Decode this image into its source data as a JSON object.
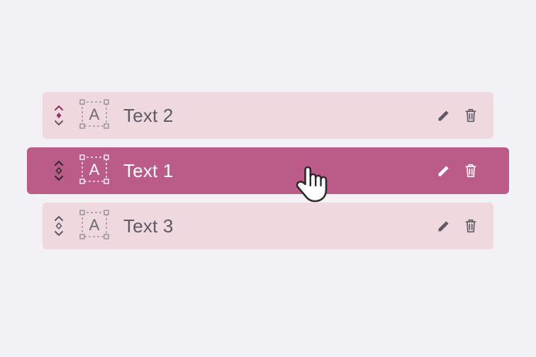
{
  "colors": {
    "row_normal_bg": "#f0d8df",
    "row_active_bg": "#ba5b88",
    "text_muted": "#5b5b66",
    "text_on_active": "#ffffff",
    "accent_magenta": "#9b2a6a",
    "icon_gray": "#5b5b66"
  },
  "rows": [
    {
      "label": "Text 2",
      "state": "normal",
      "drag_top_highlight": true
    },
    {
      "label": "Text 1",
      "state": "active",
      "drag_top_highlight": false
    },
    {
      "label": "Text 3",
      "state": "normal",
      "drag_top_highlight": false
    }
  ]
}
